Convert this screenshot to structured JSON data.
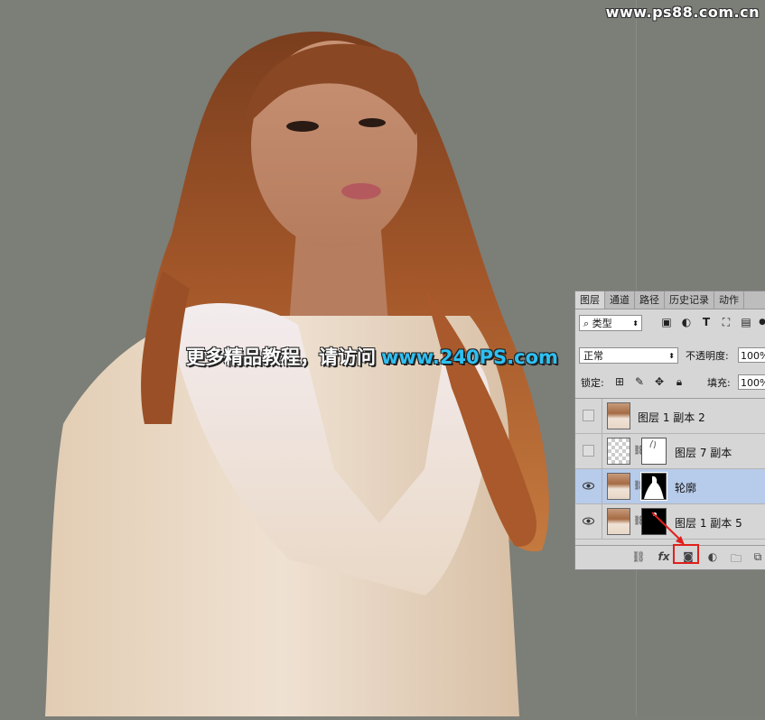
{
  "site": {
    "url": "www.ps88.com.cn"
  },
  "watermark": {
    "text": "更多精品教程，请访问",
    "url": "www.240PS.com"
  },
  "panel": {
    "tabs": [
      "图层",
      "通道",
      "路径",
      "历史记录",
      "动作"
    ],
    "filter": {
      "label": "类型"
    },
    "blend_mode": "正常",
    "opacity": {
      "label": "不透明度:",
      "value": "100%"
    },
    "lock": {
      "label": "锁定:"
    },
    "fill": {
      "label": "填充:",
      "value": "100%"
    },
    "layers": [
      {
        "name": "图层 1 副本 2",
        "visible": false,
        "has_mask": false,
        "selected": false
      },
      {
        "name": "图层 7 副本",
        "visible": false,
        "has_mask": true,
        "selected": false
      },
      {
        "name": "轮廓",
        "visible": true,
        "has_mask": true,
        "selected": true
      },
      {
        "name": "图层 1 副本 5",
        "visible": true,
        "has_mask": true,
        "selected": false
      }
    ],
    "bottom_icons": [
      "link-layers-icon",
      "fx-icon",
      "add-mask-icon",
      "adjustment-layer-icon",
      "new-group-icon",
      "new-layer-icon"
    ],
    "highlight_color": "#e0201c"
  }
}
